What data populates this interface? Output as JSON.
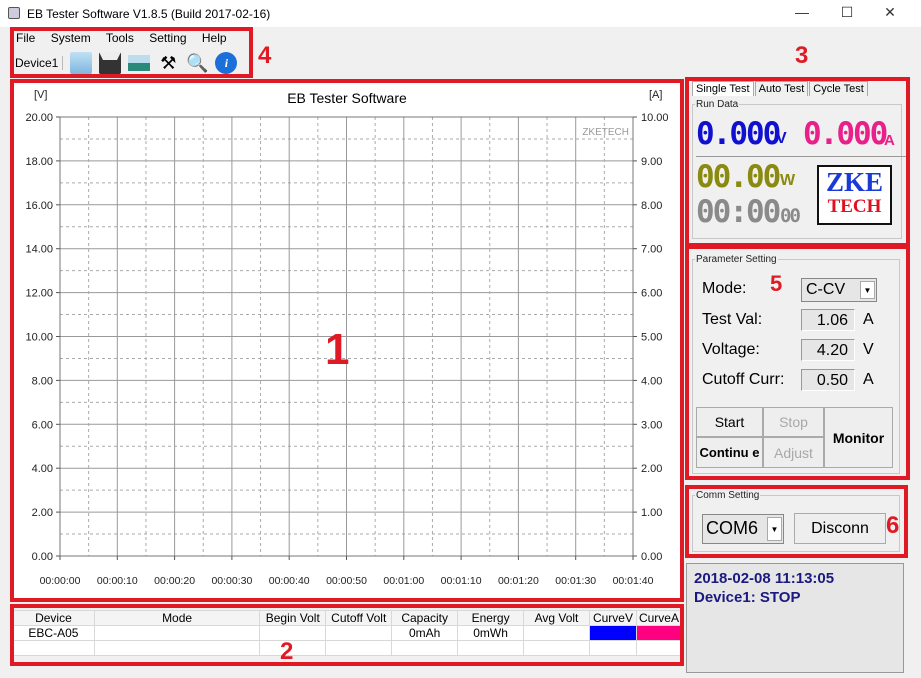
{
  "window": {
    "title": "EB Tester Software V1.8.5 (Build 2017-02-16)",
    "minimize": "—",
    "maximize": "☐",
    "close": "✕"
  },
  "menu": [
    "File",
    "System",
    "Tools",
    "Setting",
    "Help"
  ],
  "toolbar": {
    "device": "Device1",
    "icons": [
      "open-folder-icon",
      "save-icon",
      "image-icon",
      "tools-icon",
      "search-icon",
      "info-icon"
    ]
  },
  "chart_data": {
    "type": "line",
    "title": "EB Tester Software",
    "watermark": "ZKETECH",
    "ylabel": "[V]",
    "y2label": "[A]",
    "ylim": [
      0,
      20
    ],
    "y2lim": [
      0,
      10
    ],
    "yticks": [
      "0.00",
      "2.00",
      "4.00",
      "6.00",
      "8.00",
      "10.00",
      "12.00",
      "14.00",
      "16.00",
      "18.00",
      "20.00"
    ],
    "y2ticks": [
      "0.00",
      "1.00",
      "2.00",
      "3.00",
      "4.00",
      "5.00",
      "6.00",
      "7.00",
      "8.00",
      "9.00",
      "10.00"
    ],
    "xticks": [
      "00:00:00",
      "00:00:10",
      "00:00:20",
      "00:00:30",
      "00:00:40",
      "00:00:50",
      "00:01:00",
      "00:01:10",
      "00:01:20",
      "00:01:30",
      "00:01:40"
    ],
    "xlim_seconds": [
      0,
      100
    ],
    "grid": true,
    "series": []
  },
  "table": {
    "headers": [
      "Device",
      "Mode",
      "Begin Volt",
      "Cutoff Volt",
      "Capacity",
      "Energy",
      "Avg Volt",
      "CurveV",
      "CurveA"
    ],
    "rows": [
      [
        "EBC-A05",
        "",
        "",
        "",
        "0mAh",
        "0mWh",
        "",
        "",
        ""
      ],
      [
        "",
        "",
        "",
        "",
        "",
        "",
        "",
        "",
        ""
      ]
    ],
    "curve_colors": {
      "v": "#0000ff",
      "a": "#ff0080"
    }
  },
  "tabs": [
    "Single Test",
    "Auto Test",
    "Cycle Test"
  ],
  "run_data": {
    "legend": "Run Data",
    "voltage": "0.000",
    "voltage_unit": "V",
    "current": "0.000",
    "current_unit": "A",
    "power": "00.00",
    "power_unit": "W",
    "time": "00:00",
    "time_sec": "00",
    "logo_top": "ZKE",
    "logo_bottom": "TECH"
  },
  "params": {
    "legend": "Parameter Setting",
    "mode_label": "Mode:",
    "mode_value": "C-CV",
    "test_val_label": "Test Val:",
    "test_val": "1.06",
    "test_val_unit": "A",
    "voltage_label": "Voltage:",
    "voltage": "4.20",
    "voltage_unit": "V",
    "cutoff_label": "Cutoff Curr:",
    "cutoff": "0.50",
    "cutoff_unit": "A",
    "start": "Start",
    "stop": "Stop",
    "continue": "Continu e",
    "adjust": "Adjust",
    "monitor": "Monitor"
  },
  "comm": {
    "legend": "Comm Setting",
    "port": "COM6",
    "disconnect": "Disconn"
  },
  "status": {
    "line1": "2018-02-08 11:13:05",
    "line2": "Device1: STOP"
  },
  "annotations": [
    "1",
    "2",
    "3",
    "4",
    "5",
    "6"
  ],
  "colors": {
    "voltage": "#1010d0",
    "current": "#e8208a",
    "power": "#8a8a10",
    "time": "#8a8a8a",
    "annotation": "#e01a24"
  }
}
